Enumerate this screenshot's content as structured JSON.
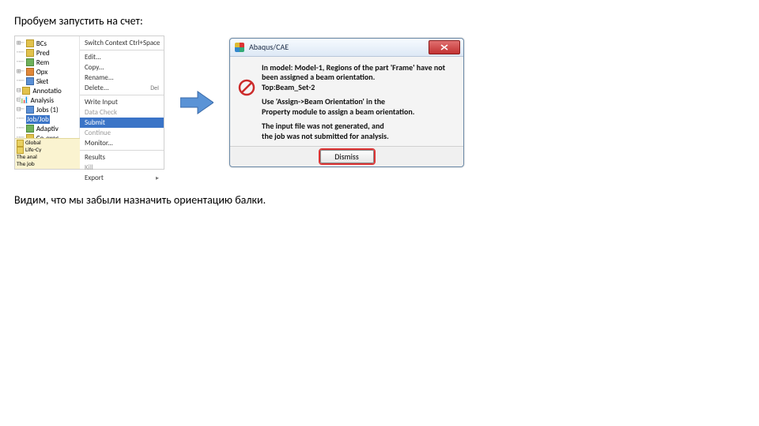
{
  "para_top": "Пробуем запустить на счет:",
  "para_bottom": "Видим, что мы забыли назначить ориентацию балки.",
  "tree": {
    "items": [
      {
        "label": "BCs"
      },
      {
        "label": "Pred"
      },
      {
        "label": "Rem"
      },
      {
        "label": "Opx"
      },
      {
        "label": "Sket"
      }
    ],
    "annot": "Annotatio",
    "analysis": "Analysis",
    "jobs_row": "Jobs (1)",
    "selected": "Job/Job",
    "adaptiv": "Adaptiv",
    "coexec": "Co-exec"
  },
  "bottom": {
    "r1": "Global",
    "r2": "Life-Cy",
    "r3": "The anal",
    "r4": "The job"
  },
  "menu": {
    "m0": "Switch Context Ctrl+Space",
    "m1": "Edit...",
    "m2": "Copy...",
    "m3": "Rename...",
    "m4": "Delete...",
    "m4r": "Del",
    "m5": "Write Input",
    "m6": "Data Check",
    "m7": "Submit",
    "m8": "Continue",
    "m9": "Monitor...",
    "m10": "Results",
    "m11": "Kill",
    "m12": "Export"
  },
  "dialog": {
    "title": "Abaqus/CAE",
    "line1": "In model: Model-1, Regions of the part 'Frame' have not",
    "line2": "been assigned a beam orientation.",
    "line3": "Top:Beam_Set-2",
    "line4": "Use 'Assign->Beam Orientation' in the",
    "line5": "Property module to assign a beam orientation.",
    "line6": "The input file was not generated, and",
    "line7": "the job was not submitted for analysis.",
    "button": "Dismiss"
  }
}
